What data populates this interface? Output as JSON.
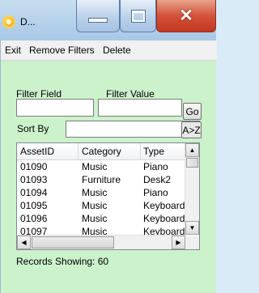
{
  "window": {
    "title": "D..."
  },
  "menu": [
    "Exit",
    "Remove Filters",
    "Delete"
  ],
  "filter": {
    "field_label": "Filter Field",
    "value_label": "Filter Value",
    "field_value": "",
    "value_value": "",
    "go_label": "Go"
  },
  "sort": {
    "label": "Sort By",
    "selected": "",
    "order_label": "A>Z"
  },
  "grid": {
    "columns": [
      "AssetID",
      "Category",
      "Type"
    ],
    "rows": [
      [
        "01090",
        "Music",
        "Piano"
      ],
      [
        "01093",
        "Furniture",
        "Desk2"
      ],
      [
        "01094",
        "Music",
        "Piano"
      ],
      [
        "01095",
        "Music",
        "Keyboard"
      ],
      [
        "01096",
        "Music",
        "Keyboard"
      ],
      [
        "01097",
        "Music",
        "Keyboard"
      ]
    ]
  },
  "status": {
    "records_text": "Records Showing: 60"
  },
  "colors": {
    "client_bg": "#ccf2cc",
    "close_button": "#d3523a",
    "titlebar": "#b4d0ea"
  }
}
